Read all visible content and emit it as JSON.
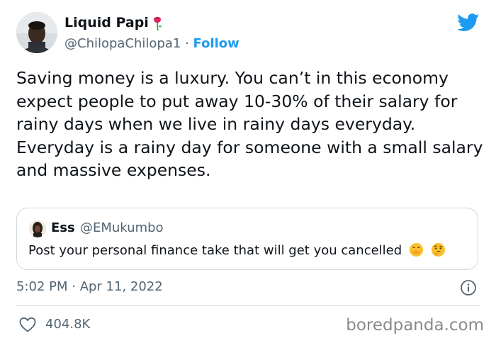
{
  "author": {
    "display_name": "Liquid Papi",
    "name_emoji": "rose-emoji",
    "handle": "@ChilopaChilopa1",
    "separator": " · ",
    "follow_label": "Follow"
  },
  "tweet": {
    "paragraphs": [
      "Saving money is a luxury. You can’t in this economy expect people to put away 10-30% of their salary for rainy days when we live in rainy days everyday.",
      "Everyday is a rainy day for someone with a small salary and massive expenses."
    ]
  },
  "quote": {
    "display_name": "Ess",
    "handle": "@EMukumbo",
    "text": "Post your personal finance take that will get you cancelled",
    "emojis": [
      "face-with-hand-over-mouth-emoji",
      "thinking-face-emoji"
    ]
  },
  "timestamp": "5:02 PM · Apr 11, 2022",
  "likes": "404.8K",
  "watermark": "boredpanda.com",
  "colors": {
    "accent": "#1d9bf0",
    "text": "#0f1419",
    "secondary": "#536471",
    "border": "#cfd9de"
  },
  "icons": {
    "brand": "twitter-bird-icon",
    "info": "info-icon",
    "like": "heart-icon"
  }
}
